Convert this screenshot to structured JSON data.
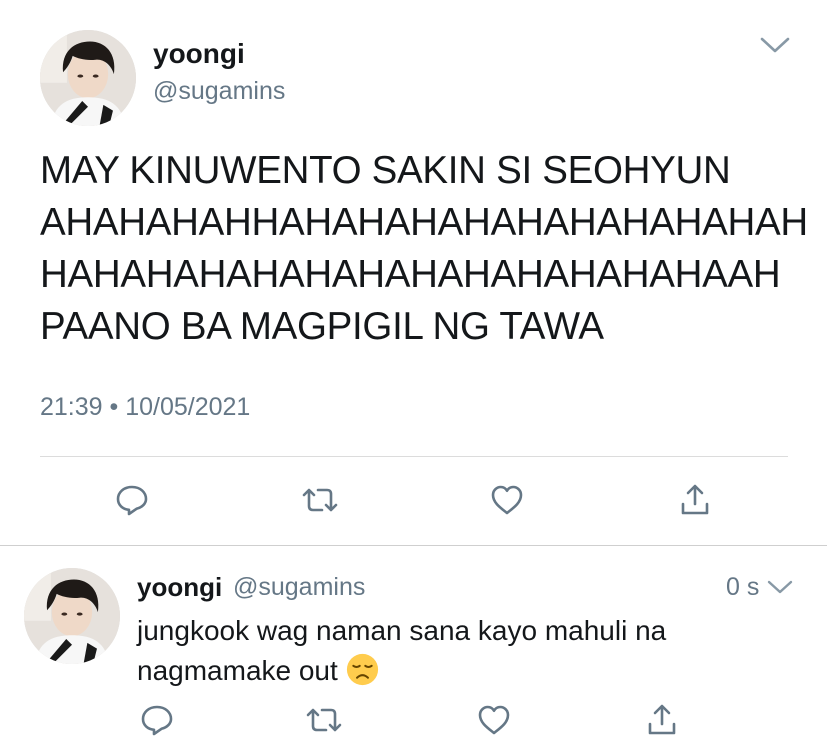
{
  "main_tweet": {
    "display_name": "yoongi",
    "handle": "@sugamins",
    "text_lines": [
      "MAY KINUWENTO SAKIN SI SEOHYUN",
      "AHAHAHAHHAHAHAHAHAHAHAHAHAHAH",
      "HAHAHAHAHAHAHAHAHAHAHAHAHAAH",
      "PAANO BA MAGPIGIL NG TAWA"
    ],
    "timestamp": "21:39 • 10/05/2021",
    "actions": [
      "reply-icon",
      "retweet-icon",
      "like-icon",
      "share-icon"
    ]
  },
  "reply_tweet": {
    "display_name": "yoongi",
    "handle": "@sugamins",
    "time_ago": "0 s",
    "text_line1": "jungkook wag naman sana kayo mahuli na",
    "text_line2": "nagmamake out",
    "emoji": "disappointed-face-emoji",
    "actions": [
      "reply-icon",
      "retweet-icon",
      "like-icon",
      "share-icon"
    ]
  },
  "colors": {
    "text_primary": "#14171a",
    "text_secondary": "#657786",
    "icon_gray": "#657786",
    "divider": "#dcdcdc",
    "background": "#ffffff"
  }
}
